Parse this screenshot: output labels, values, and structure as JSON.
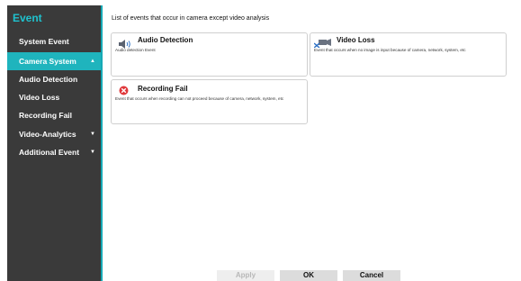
{
  "sidebar": {
    "title": "Event",
    "items": [
      {
        "label": "System Event"
      },
      {
        "label": "Camera System",
        "caret": "▲"
      },
      {
        "label": "Audio Detection"
      },
      {
        "label": "Video Loss"
      },
      {
        "label": "Recording Fail"
      },
      {
        "label": "Video-Analytics",
        "caret": "▼"
      },
      {
        "label": "Additional Event",
        "caret": "▼"
      }
    ]
  },
  "main": {
    "heading": "List of events that occur in camera except video analysis",
    "cards": [
      {
        "title": "Audio Detection",
        "desc": "Audio detection Event",
        "icon": "speaker-icon"
      },
      {
        "title": "Video Loss",
        "desc": "Event that occurs when no image is input because of camera, network, system, etc",
        "icon": "video-loss-icon"
      },
      {
        "title": "Recording Fail",
        "desc": "Event that occurs when recording can not proceed because of camera, network, system, etc",
        "icon": "recording-fail-icon"
      }
    ]
  },
  "footer": {
    "apply_label": "Apply",
    "ok_label": "OK",
    "cancel_label": "Cancel"
  },
  "colors": {
    "sidebar_bg": "#3a3a3a",
    "accent": "#1fb4bd",
    "title_accent": "#1fc2ce",
    "record_fail_red": "#e0383b"
  }
}
